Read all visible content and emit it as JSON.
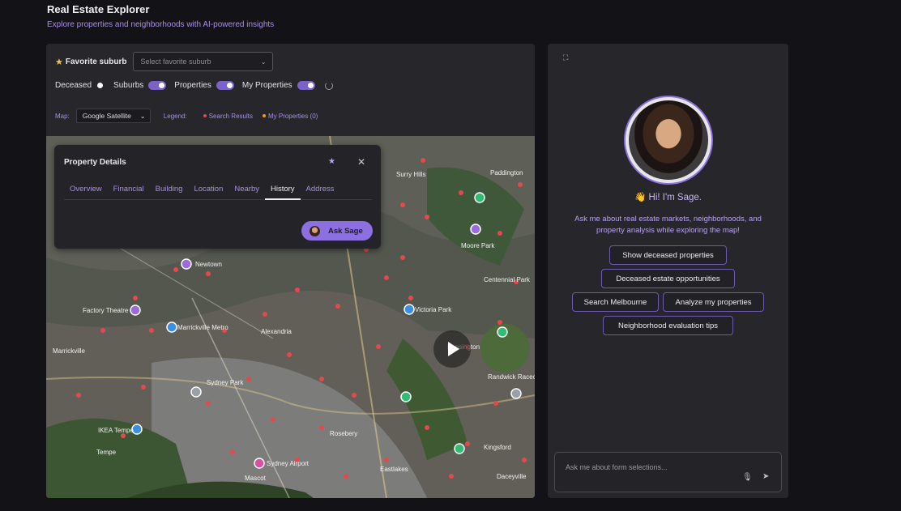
{
  "header": {
    "title": "Real Estate Explorer",
    "subtitle": "Explore properties and neighborhoods with AI-powered insights"
  },
  "filters": {
    "favorite_label": "Favorite suburb",
    "favorite_placeholder": "Select favorite suburb",
    "toggles": [
      {
        "label": "Deceased",
        "on": false
      },
      {
        "label": "Suburbs",
        "on": true
      },
      {
        "label": "Properties",
        "on": true
      },
      {
        "label": "My Properties",
        "on": true
      }
    ],
    "map_label": "Map:",
    "map_type": "Google Satellite",
    "legend_label": "Legend:",
    "legend": [
      {
        "label": "Search Results",
        "color": "#e5484d"
      },
      {
        "label": "My Properties (0)",
        "color": "#f59e0b"
      }
    ]
  },
  "map": {
    "labels": [
      "Surry Hills",
      "Paddington",
      "Moore Park",
      "Newtown",
      "Marrickville Metro",
      "Marrickville",
      "Alexandria",
      "Kensington",
      "Sydney Park",
      "IKEA Tempe",
      "Tempe",
      "Rosebery",
      "Kingsford",
      "Eastlakes",
      "Daceyville",
      "Mascot",
      "Sydney Airport",
      "Victoria Park",
      "Factory Theatre",
      "Centennial Park",
      "Randwick Racecourse"
    ]
  },
  "popup": {
    "title": "Property Details",
    "tabs": [
      "Overview",
      "Financial",
      "Building",
      "Location",
      "Nearby",
      "History",
      "Address"
    ],
    "active_tab": "History",
    "ask_label": "Ask Sage"
  },
  "assistant": {
    "greeting": "👋 Hi! I'm Sage.",
    "description": "Ask me about real estate markets, neighborhoods, and property analysis while exploring the map!",
    "suggestions": [
      "Show deceased properties",
      "Deceased estate opportunities",
      "Search Melbourne",
      "Analyze my properties",
      "Neighborhood evaluation tips"
    ],
    "input_placeholder": "Ask me about form selections..."
  },
  "colors": {
    "accent": "#8c6fe0",
    "accent_text": "#a88fe0",
    "panel": "#26262b",
    "background": "#131317"
  }
}
